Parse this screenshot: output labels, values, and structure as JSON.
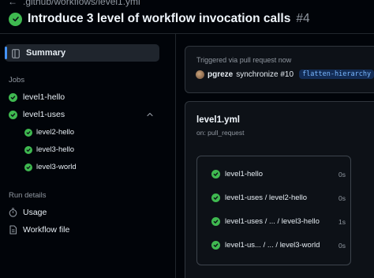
{
  "header": {
    "breadcrumb": ".github/workflows/level1.yml",
    "title": "Introduce 3 level of workflow invocation calls",
    "run_number": "#4"
  },
  "sidebar": {
    "summary_label": "Summary",
    "jobs_heading": "Jobs",
    "jobs": [
      {
        "label": "level1-hello",
        "status": "success"
      },
      {
        "label": "level1-uses",
        "status": "success",
        "expanded": true,
        "children": [
          {
            "label": "level2-hello",
            "status": "success"
          },
          {
            "label": "level3-hello",
            "status": "success"
          },
          {
            "label": "level3-world",
            "status": "success"
          }
        ]
      }
    ],
    "run_details_heading": "Run details",
    "run_details": [
      {
        "label": "Usage",
        "icon": "stopwatch-icon"
      },
      {
        "label": "Workflow file",
        "icon": "file-icon"
      }
    ]
  },
  "trigger": {
    "label": "Triggered via pull request now",
    "user": "pgreze",
    "action": "synchronize #10",
    "branch": "flatten-hierarchy"
  },
  "workflow": {
    "name": "level1.yml",
    "on": "on: pull_request",
    "jobs": [
      {
        "label": "level1-hello",
        "duration": "0s"
      },
      {
        "label": "level1-uses / level2-hello",
        "duration": "0s"
      },
      {
        "label": "level1-uses / ... / level3-hello",
        "duration": "1s"
      },
      {
        "label": "level1-us... / ... / level3-world",
        "duration": "0s"
      }
    ]
  },
  "colors": {
    "background": "#010409",
    "card": "#0d1117",
    "success": "#3fb950",
    "accent": "#4493f8",
    "muted_text": "#9198a1"
  }
}
